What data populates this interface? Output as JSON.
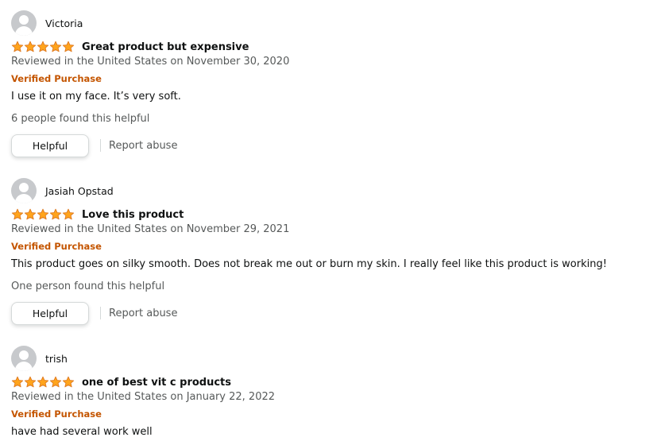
{
  "reviews": [
    {
      "name": "Victoria",
      "rating": 5,
      "title": "Great product but expensive",
      "date": "Reviewed in the United States on November 30, 2020",
      "verified": "Verified Purchase",
      "body": "I use it on my face. It’s very soft.",
      "helpful_count": "6 people found this helpful",
      "helpful_label": "Helpful",
      "report_label": "Report abuse"
    },
    {
      "name": "Jasiah Opstad",
      "rating": 5,
      "title": "Love this product",
      "date": "Reviewed in the United States on November 29, 2021",
      "verified": "Verified Purchase",
      "body": "This product goes on silky smooth. Does not break me out or burn my skin. I really feel like this product is working!",
      "helpful_count": "One person found this helpful",
      "helpful_label": "Helpful",
      "report_label": "Report abuse"
    },
    {
      "name": "trish",
      "rating": 5,
      "title": "one of best vit c products",
      "date": "Reviewed in the United States on January 22, 2022",
      "verified": "Verified Purchase",
      "body": "have had several work well"
    }
  ],
  "colors": {
    "star": "#ffa41c",
    "star_outline": "#de7921",
    "verified": "#c45500",
    "secondary_text": "#565959"
  }
}
